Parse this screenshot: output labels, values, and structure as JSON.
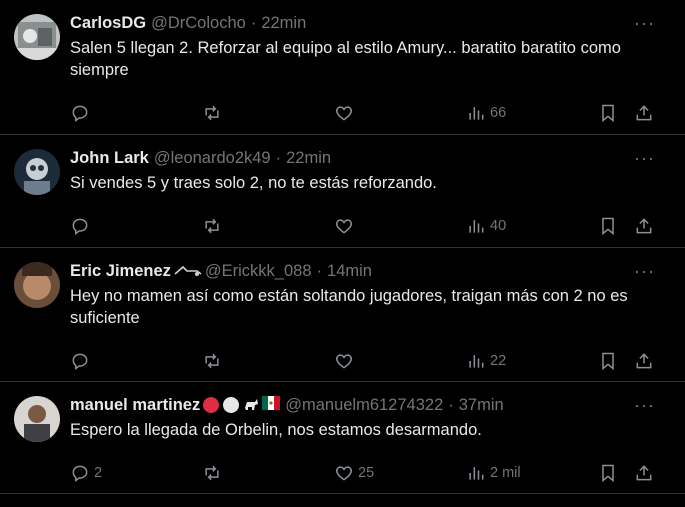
{
  "tweets": [
    {
      "name": "CarlosDG",
      "handle": "@DrColocho",
      "dot": "·",
      "time": "22min",
      "text": "Salen 5 llegan 2. Reforzar al equipo al estilo Amury... baratito baratito como siempre",
      "replies": "",
      "retweets": "",
      "likes": "",
      "views": "66"
    },
    {
      "name": "John Lark",
      "handle": "@leonardo2k49",
      "dot": "·",
      "time": "22min",
      "text": "Si vendes 5 y traes solo 2, no te estás reforzando.",
      "replies": "",
      "retweets": "",
      "likes": "",
      "views": "40"
    },
    {
      "name": "Eric Jimenez",
      "handle": "@Erickkk_088",
      "dot": "·",
      "time": "14min",
      "text": "Hey no mamen así como están soltando jugadores, traigan más con 2 no es suficiente",
      "replies": "",
      "retweets": "",
      "likes": "",
      "views": "22"
    },
    {
      "name": "manuel martinez",
      "handle": "@manuelm61274322",
      "dot": "·",
      "time": "37min",
      "text": "Espero la llegada de Orbelin, nos estamos desarmando.",
      "replies": "2",
      "retweets": "",
      "likes": "25",
      "views": "2 mil"
    }
  ],
  "more_label": "···",
  "colors": {
    "background": "#000000",
    "text": "#e7e9ea",
    "muted": "#71767b",
    "divider": "#2f3336"
  }
}
